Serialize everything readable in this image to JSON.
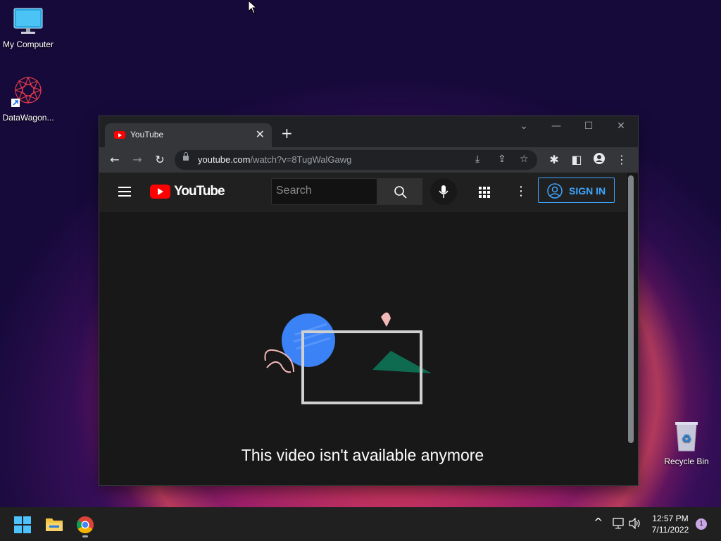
{
  "desktop": {
    "icons": [
      {
        "label": "My Computer"
      },
      {
        "label": "DataWagon..."
      },
      {
        "label": "Recycle Bin"
      }
    ]
  },
  "browser": {
    "tab": {
      "title": "YouTube"
    },
    "new_tab": "+",
    "url_host": "youtube.com",
    "url_path": "/watch?v=8TugWalGawg"
  },
  "youtube": {
    "logo_text": "YouTube",
    "search_placeholder": "Search",
    "sign_in_label": "SIGN IN",
    "message": "This video isn't available anymore"
  },
  "taskbar": {
    "time": "12:57 PM",
    "date": "7/11/2022",
    "notification_count": "1"
  },
  "colors": {
    "youtube_red": "#ff0000",
    "signin_blue": "#3ea6ff"
  }
}
